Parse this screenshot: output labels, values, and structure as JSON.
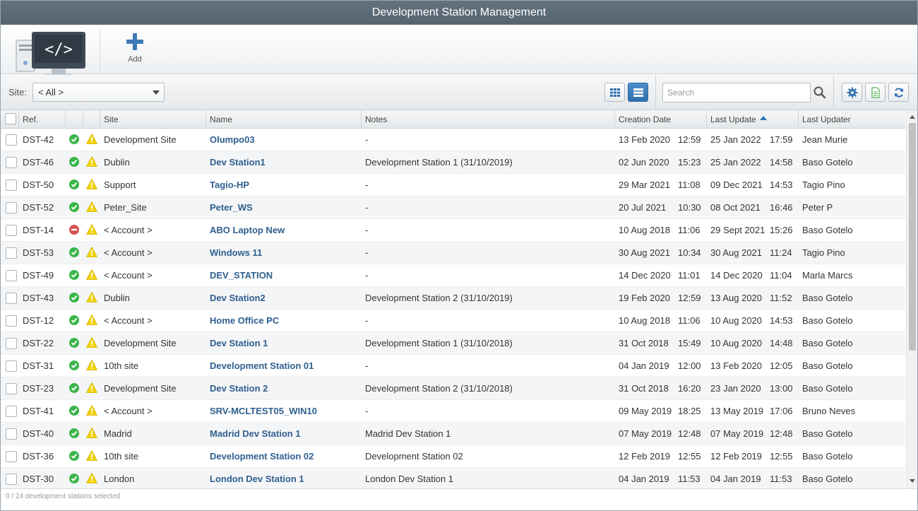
{
  "window": {
    "title": "Development Station Management"
  },
  "header": {
    "add_label": "Add"
  },
  "toolbar": {
    "site_label": "Site:",
    "site_value": "< All >",
    "search_placeholder": "Search"
  },
  "columns": {
    "ref": "Ref.",
    "site": "Site",
    "name": "Name",
    "notes": "Notes",
    "creation_date": "Creation Date",
    "last_update": "Last Update",
    "last_updater": "Last Updater"
  },
  "colors": {
    "status_ok": "#3ab54a",
    "status_blocked": "#d9534f",
    "warning": "#f2d200",
    "link": "#2f5f8f",
    "accent": "#2f6fae"
  },
  "rows": [
    {
      "ref": "DST-42",
      "status": "ok",
      "site": "Development Site",
      "name": "Olumpo03",
      "notes": "-",
      "created_date": "13 Feb 2020",
      "created_time": "12:59",
      "updated_date": "25 Jan 2022",
      "updated_time": "17:59",
      "updater": "Jean Murie"
    },
    {
      "ref": "DST-46",
      "status": "ok",
      "site": "Dublin",
      "name": "Dev Station1",
      "notes": "Development Station 1 (31/10/2019)",
      "created_date": "02 Jun 2020",
      "created_time": "15:23",
      "updated_date": "25 Jan 2022",
      "updated_time": "14:58",
      "updater": "Baso Gotelo"
    },
    {
      "ref": "DST-50",
      "status": "ok",
      "site": "Support",
      "name": "Tagio-HP",
      "notes": "-",
      "created_date": "29 Mar 2021",
      "created_time": "11:08",
      "updated_date": "09 Dec 2021",
      "updated_time": "14:53",
      "updater": "Tagio Pino"
    },
    {
      "ref": "DST-52",
      "status": "ok",
      "site": "Peter_Site",
      "name": "Peter_WS",
      "notes": "-",
      "created_date": "20 Jul 2021",
      "created_time": "10:30",
      "updated_date": "08 Oct 2021",
      "updated_time": "16:46",
      "updater": "Peter P"
    },
    {
      "ref": "DST-14",
      "status": "blocked",
      "site": "< Account >",
      "name": "ABO Laptop New",
      "notes": "-",
      "created_date": "10 Aug 2018",
      "created_time": "11:06",
      "updated_date": "29 Sept 2021",
      "updated_time": "15:26",
      "updater": "Baso Gotelo"
    },
    {
      "ref": "DST-53",
      "status": "ok",
      "site": "< Account >",
      "name": "Windows 11",
      "notes": "-",
      "created_date": "30 Aug 2021",
      "created_time": "10:34",
      "updated_date": "30 Aug 2021",
      "updated_time": "11:24",
      "updater": "Tagio Pino"
    },
    {
      "ref": "DST-49",
      "status": "ok",
      "site": "< Account >",
      "name": "DEV_STATION",
      "notes": "-",
      "created_date": "14 Dec 2020",
      "created_time": "11:01",
      "updated_date": "14 Dec 2020",
      "updated_time": "11:04",
      "updater": "Marla Marcs"
    },
    {
      "ref": "DST-43",
      "status": "ok",
      "site": "Dublin",
      "name": "Dev Station2",
      "notes": "Development Station 2 (31/10/2019)",
      "created_date": "19 Feb 2020",
      "created_time": "12:59",
      "updated_date": "13 Aug 2020",
      "updated_time": "11:52",
      "updater": "Baso Gotelo"
    },
    {
      "ref": "DST-12",
      "status": "ok",
      "site": "< Account >",
      "name": "Home Office PC",
      "notes": "-",
      "created_date": "10 Aug 2018",
      "created_time": "11:06",
      "updated_date": "10 Aug 2020",
      "updated_time": "14:53",
      "updater": "Baso Gotelo"
    },
    {
      "ref": "DST-22",
      "status": "ok",
      "site": "Development Site",
      "name": "Dev Station 1",
      "notes": "Development Station 1 (31/10/2018)",
      "created_date": "31 Oct 2018",
      "created_time": "15:49",
      "updated_date": "10 Aug 2020",
      "updated_time": "14:48",
      "updater": "Baso Gotelo"
    },
    {
      "ref": "DST-31",
      "status": "ok",
      "site": "10th site",
      "name": "Development Station 01",
      "notes": "-",
      "created_date": "04 Jan 2019",
      "created_time": "12:00",
      "updated_date": "13 Feb 2020",
      "updated_time": "12:05",
      "updater": "Baso Gotelo"
    },
    {
      "ref": "DST-23",
      "status": "ok",
      "site": "Development Site",
      "name": "Dev Station 2",
      "notes": "Development Station 2 (31/10/2018)",
      "created_date": "31 Oct 2018",
      "created_time": "16:20",
      "updated_date": "23 Jan 2020",
      "updated_time": "13:00",
      "updater": "Baso Gotelo"
    },
    {
      "ref": "DST-41",
      "status": "ok",
      "site": "< Account >",
      "name": "SRV-MCLTEST05_WIN10",
      "notes": "-",
      "created_date": "09 May 2019",
      "created_time": "18:25",
      "updated_date": "13 May 2019",
      "updated_time": "17:06",
      "updater": "Bruno Neves"
    },
    {
      "ref": "DST-40",
      "status": "ok",
      "site": "Madrid",
      "name": "Madrid Dev Station 1",
      "notes": "Madrid Dev Station 1",
      "created_date": "07 May 2019",
      "created_time": "12:48",
      "updated_date": "07 May 2019",
      "updated_time": "12:48",
      "updater": "Baso Gotelo"
    },
    {
      "ref": "DST-36",
      "status": "ok",
      "site": "10th site",
      "name": "Development Station 02",
      "notes": "Development Station 02",
      "created_date": "12 Feb 2019",
      "created_time": "12:55",
      "updated_date": "12 Feb 2019",
      "updated_time": "12:55",
      "updater": "Baso Gotelo"
    },
    {
      "ref": "DST-30",
      "status": "ok",
      "site": "London",
      "name": "London Dev Station 1",
      "notes": "London Dev Station 1",
      "created_date": "04 Jan 2019",
      "created_time": "11:53",
      "updated_date": "04 Jan 2019",
      "updated_time": "11:53",
      "updater": "Baso Gotelo"
    }
  ],
  "status_bar": {
    "text": "0 / 24 development stations selected"
  }
}
